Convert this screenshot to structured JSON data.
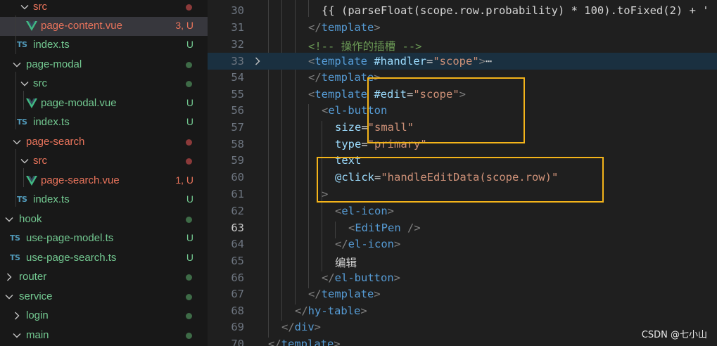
{
  "explorer": {
    "items": [
      {
        "label": "src",
        "type": "folder",
        "open": true,
        "color": "#e8735b",
        "status": "dot",
        "status_color": "#8c3a3a"
      },
      {
        "label": "page-content.vue",
        "type": "vue",
        "color": "#e8735b",
        "status": "3, U",
        "status_color": "#e8735b",
        "selected": true
      },
      {
        "label": "index.ts",
        "type": "ts",
        "color": "#73c991",
        "status": "U",
        "status_color": "#73c991"
      },
      {
        "label": "page-modal",
        "type": "folder",
        "open": true,
        "color": "#73c991",
        "status": "dot",
        "status_color": "#3e6b47"
      },
      {
        "label": "src",
        "type": "folder",
        "open": true,
        "color": "#73c991",
        "status": "dot",
        "status_color": "#3e6b47"
      },
      {
        "label": "page-modal.vue",
        "type": "vue",
        "color": "#73c991",
        "status": "U",
        "status_color": "#73c991"
      },
      {
        "label": "index.ts",
        "type": "ts",
        "color": "#73c991",
        "status": "U",
        "status_color": "#73c991"
      },
      {
        "label": "page-search",
        "type": "folder",
        "open": true,
        "color": "#e8735b",
        "status": "dot",
        "status_color": "#8c3a3a"
      },
      {
        "label": "src",
        "type": "folder",
        "open": true,
        "color": "#e8735b",
        "status": "dot",
        "status_color": "#8c3a3a"
      },
      {
        "label": "page-search.vue",
        "type": "vue",
        "color": "#e8735b",
        "status": "1, U",
        "status_color": "#e8735b"
      },
      {
        "label": "index.ts",
        "type": "ts",
        "color": "#73c991",
        "status": "U",
        "status_color": "#73c991"
      },
      {
        "label": "hook",
        "type": "folder",
        "open": true,
        "color": "#73c991",
        "status": "dot",
        "status_color": "#3e6b47"
      },
      {
        "label": "use-page-model.ts",
        "type": "ts",
        "color": "#73c991",
        "status": "U",
        "status_color": "#73c991"
      },
      {
        "label": "use-page-search.ts",
        "type": "ts",
        "color": "#73c991",
        "status": "U",
        "status_color": "#73c991"
      },
      {
        "label": "router",
        "type": "folder",
        "open": false,
        "color": "#73c991",
        "status": "dot",
        "status_color": "#3e6b47"
      },
      {
        "label": "service",
        "type": "folder",
        "open": true,
        "color": "#73c991",
        "status": "dot",
        "status_color": "#3e6b47"
      },
      {
        "label": "login",
        "type": "folder",
        "open": false,
        "color": "#73c991",
        "status": "dot",
        "status_color": "#3e6b47"
      },
      {
        "label": "main",
        "type": "folder",
        "open": true,
        "color": "#73c991",
        "status": "dot",
        "status_color": "#3e6b47"
      }
    ],
    "ts_badge": "TS"
  },
  "editor": {
    "lines": [
      {
        "no": "30",
        "tokens": [
          {
            "t": "{{ (parseFloat(scope.row.probability) * 100).toFixed(2) + '",
            "c": "c-plain"
          }
        ]
      },
      {
        "no": "31",
        "tokens": [
          {
            "t": "</",
            "c": "c-punc"
          },
          {
            "t": "template",
            "c": "c-tag"
          },
          {
            "t": ">",
            "c": "c-punc"
          }
        ]
      },
      {
        "no": "32",
        "tokens": [
          {
            "t": "<!-- 操作的插槽 -->",
            "c": "c-comment"
          }
        ]
      },
      {
        "no": "33",
        "tokens": [
          {
            "t": "<",
            "c": "c-punc"
          },
          {
            "t": "template",
            "c": "c-tag"
          },
          {
            "t": " #handler",
            "c": "c-attr"
          },
          {
            "t": "=",
            "c": "c-plain"
          },
          {
            "t": "\"scope\"",
            "c": "c-str"
          },
          {
            "t": ">",
            "c": "c-punc"
          },
          {
            "t": "⋯",
            "c": "c-plain"
          }
        ]
      },
      {
        "no": "54",
        "tokens": [
          {
            "t": "</",
            "c": "c-punc"
          },
          {
            "t": "template",
            "c": "c-tag"
          },
          {
            "t": ">",
            "c": "c-punc"
          }
        ]
      },
      {
        "no": "55",
        "tokens": [
          {
            "t": "<",
            "c": "c-punc"
          },
          {
            "t": "template",
            "c": "c-tag"
          },
          {
            "t": " #edit",
            "c": "c-attr"
          },
          {
            "t": "=",
            "c": "c-plain"
          },
          {
            "t": "\"scope\"",
            "c": "c-str"
          },
          {
            "t": ">",
            "c": "c-punc"
          }
        ]
      },
      {
        "no": "56",
        "tokens": [
          {
            "t": "<",
            "c": "c-punc"
          },
          {
            "t": "el-button",
            "c": "c-tag"
          }
        ]
      },
      {
        "no": "57",
        "tokens": [
          {
            "t": "size",
            "c": "c-attr"
          },
          {
            "t": "=",
            "c": "c-plain"
          },
          {
            "t": "\"small\"",
            "c": "c-str"
          }
        ]
      },
      {
        "no": "58",
        "tokens": [
          {
            "t": "type",
            "c": "c-attr"
          },
          {
            "t": "=",
            "c": "c-plain"
          },
          {
            "t": "\"primary\"",
            "c": "c-str"
          }
        ]
      },
      {
        "no": "59",
        "tokens": [
          {
            "t": "text",
            "c": "c-attr"
          }
        ]
      },
      {
        "no": "60",
        "tokens": [
          {
            "t": "@click",
            "c": "c-attr"
          },
          {
            "t": "=",
            "c": "c-plain"
          },
          {
            "t": "\"handleEditData(scope.row)\"",
            "c": "c-str"
          }
        ]
      },
      {
        "no": "61",
        "tokens": [
          {
            "t": ">",
            "c": "c-punc"
          }
        ]
      },
      {
        "no": "62",
        "tokens": [
          {
            "t": "<",
            "c": "c-punc"
          },
          {
            "t": "el-icon",
            "c": "c-tag"
          },
          {
            "t": ">",
            "c": "c-punc"
          }
        ]
      },
      {
        "no": "63",
        "tokens": [
          {
            "t": "<",
            "c": "c-punc"
          },
          {
            "t": "EditPen",
            "c": "c-tag"
          },
          {
            "t": " />",
            "c": "c-punc"
          }
        ]
      },
      {
        "no": "64",
        "tokens": [
          {
            "t": "</",
            "c": "c-punc"
          },
          {
            "t": "el-icon",
            "c": "c-tag"
          },
          {
            "t": ">",
            "c": "c-punc"
          }
        ]
      },
      {
        "no": "65",
        "tokens": [
          {
            "t": "编辑",
            "c": "c-text"
          }
        ]
      },
      {
        "no": "66",
        "tokens": [
          {
            "t": "</",
            "c": "c-punc"
          },
          {
            "t": "el-button",
            "c": "c-tag"
          },
          {
            "t": ">",
            "c": "c-punc"
          }
        ]
      },
      {
        "no": "67",
        "tokens": [
          {
            "t": "</",
            "c": "c-punc"
          },
          {
            "t": "template",
            "c": "c-tag"
          },
          {
            "t": ">",
            "c": "c-punc"
          }
        ]
      },
      {
        "no": "68",
        "tokens": [
          {
            "t": "</",
            "c": "c-punc"
          },
          {
            "t": "hy-table",
            "c": "c-tag"
          },
          {
            "t": ">",
            "c": "c-punc"
          }
        ]
      },
      {
        "no": "69",
        "tokens": [
          {
            "t": "</",
            "c": "c-punc"
          },
          {
            "t": "div",
            "c": "c-tag"
          },
          {
            "t": ">",
            "c": "c-punc"
          }
        ]
      },
      {
        "no": "70",
        "tokens": [
          {
            "t": "</",
            "c": "c-punc"
          },
          {
            "t": "template",
            "c": "c-tag"
          },
          {
            "t": ">",
            "c": "c-punc"
          }
        ]
      }
    ],
    "active_line": "63",
    "folded_line": "33"
  },
  "watermark": "CSDN @七小山",
  "colors": {
    "highlight_box": "#f4b41a",
    "vue_green": "#41b883",
    "ts_blue": "#519aba"
  }
}
